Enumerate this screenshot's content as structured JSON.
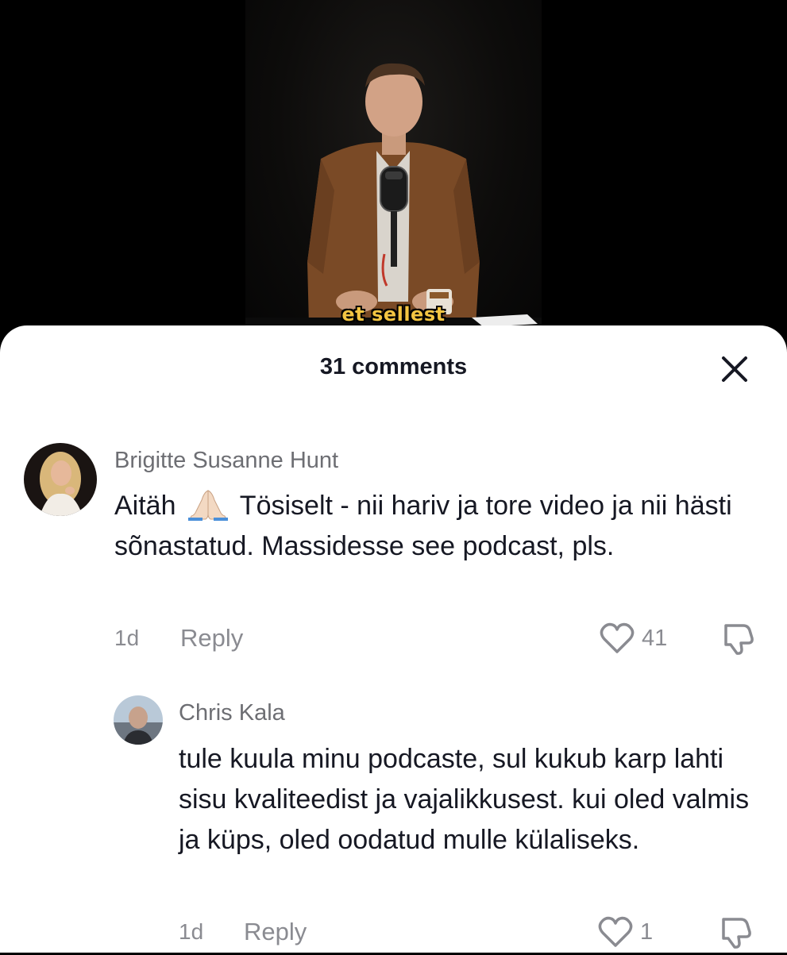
{
  "video": {
    "caption": "et sellest"
  },
  "sheet": {
    "title": "31 comments"
  },
  "comments": [
    {
      "username": "Brigitte Susanne Hunt",
      "text_before_emoji": "Aitäh",
      "emoji": "folded-hands",
      "text_after_emoji": "Tösiselt - nii hariv ja tore video ja nii hästi sõnastatud. Massidesse see podcast, pls.",
      "time": "1d",
      "reply_label": "Reply",
      "likes": "41"
    },
    {
      "username": "Chris Kala",
      "text": "tule kuula minu podcaste, sul kukub karp lahti sisu kvaliteedist ja vajalikkusest. kui oled valmis ja küps, oled oodatud mulle külaliseks.",
      "time": "1d",
      "reply_label": "Reply",
      "likes": "1"
    }
  ],
  "colors": {
    "caption": "#f4c542",
    "text": "#161823",
    "muted": "#8a8b91"
  }
}
